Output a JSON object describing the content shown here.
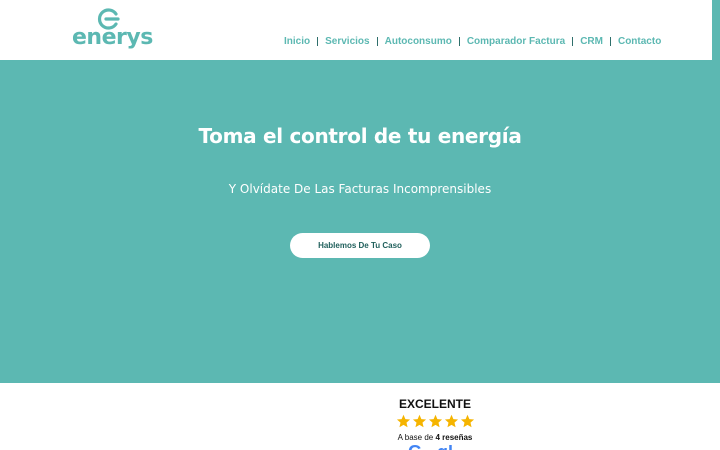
{
  "brand": {
    "name": "enerys",
    "color": "#5cb8b2"
  },
  "nav": {
    "items": [
      {
        "label": "Inicio"
      },
      {
        "label": "Servicios"
      },
      {
        "label": "Autoconsumo"
      },
      {
        "label": "Comparador Factura"
      },
      {
        "label": "CRM"
      },
      {
        "label": "Contacto"
      }
    ]
  },
  "hero": {
    "title": "Toma el control de tu energía",
    "subtitle": "Y Olvídate De Las Facturas Incomprensibles",
    "cta_label": "Hablemos De Tu Caso",
    "background": "#5cb8b2"
  },
  "reviews": {
    "rating_label": "EXCELENTE",
    "stars": 5,
    "star_color": "#f5b400",
    "count_prefix": "A base de",
    "count_value": "4 reseñas",
    "source_icon": "google-logo-icon"
  }
}
